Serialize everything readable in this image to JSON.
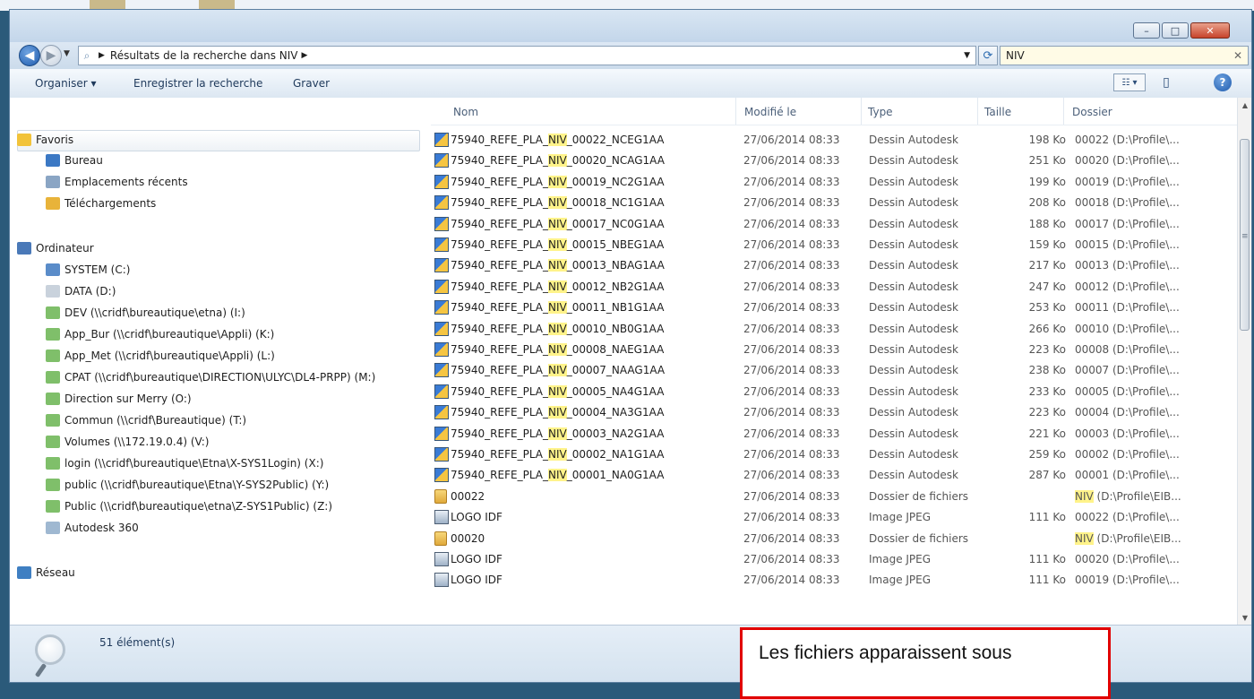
{
  "address": {
    "path": "Résultats de la recherche dans NIV",
    "search_value": "NIV"
  },
  "window_controls": {
    "minimize": "–",
    "maximize": "□",
    "close": "✕"
  },
  "toolbar": {
    "organize": "Organiser ▾",
    "save_search": "Enregistrer la recherche",
    "burn": "Graver",
    "view_menu": "☷ ▾",
    "help": "?"
  },
  "nav": {
    "favorites": {
      "label": "Favoris",
      "items": [
        "Bureau",
        "Emplacements récents",
        "Téléchargements"
      ]
    },
    "computer": {
      "label": "Ordinateur",
      "items": [
        "SYSTEM (C:)",
        "DATA (D:)",
        "DEV (\\\\cridf\\bureautique\\etna) (I:)",
        "App_Bur (\\\\cridf\\bureautique\\Appli) (K:)",
        "App_Met (\\\\cridf\\bureautique\\Appli) (L:)",
        "CPAT (\\\\cridf\\bureautique\\DIRECTION\\ULYC\\DL4-PRPP) (M:)",
        "Direction sur Merry (O:)",
        "Commun (\\\\cridf\\Bureautique) (T:)",
        "Volumes (\\\\172.19.0.4) (V:)",
        "login (\\\\cridf\\bureautique\\Etna\\X-SYS1Login) (X:)",
        "public (\\\\cridf\\bureautique\\Etna\\Y-SYS2Public) (Y:)",
        "Public (\\\\cridf\\bureautique\\etna\\Z-SYS1Public) (Z:)",
        "Autodesk 360"
      ]
    },
    "network": {
      "label": "Réseau"
    }
  },
  "columns": {
    "name": "Nom",
    "modified": "Modifié le",
    "type": "Type",
    "size": "Taille",
    "folder": "Dossier"
  },
  "files": [
    {
      "pre": "75940_REFE_PLA_",
      "hl": "NIV",
      "post": "_00022_NCEG1AA",
      "date": "27/06/2014 08:33",
      "type": "Dessin Autodesk",
      "size": "198 Ko",
      "fhl": "",
      "folder": "00022 (D:\\Profile\\...",
      "icon": "dwg"
    },
    {
      "pre": "75940_REFE_PLA_",
      "hl": "NIV",
      "post": "_00020_NCAG1AA",
      "date": "27/06/2014 08:33",
      "type": "Dessin Autodesk",
      "size": "251 Ko",
      "fhl": "",
      "folder": "00020 (D:\\Profile\\...",
      "icon": "dwg"
    },
    {
      "pre": "75940_REFE_PLA_",
      "hl": "NIV",
      "post": "_00019_NC2G1AA",
      "date": "27/06/2014 08:33",
      "type": "Dessin Autodesk",
      "size": "199 Ko",
      "fhl": "",
      "folder": "00019 (D:\\Profile\\...",
      "icon": "dwg"
    },
    {
      "pre": "75940_REFE_PLA_",
      "hl": "NIV",
      "post": "_00018_NC1G1AA",
      "date": "27/06/2014 08:33",
      "type": "Dessin Autodesk",
      "size": "208 Ko",
      "fhl": "",
      "folder": "00018 (D:\\Profile\\...",
      "icon": "dwg"
    },
    {
      "pre": "75940_REFE_PLA_",
      "hl": "NIV",
      "post": "_00017_NC0G1AA",
      "date": "27/06/2014 08:33",
      "type": "Dessin Autodesk",
      "size": "188 Ko",
      "fhl": "",
      "folder": "00017 (D:\\Profile\\...",
      "icon": "dwg"
    },
    {
      "pre": "75940_REFE_PLA_",
      "hl": "NIV",
      "post": "_00015_NBEG1AA",
      "date": "27/06/2014 08:33",
      "type": "Dessin Autodesk",
      "size": "159 Ko",
      "fhl": "",
      "folder": "00015 (D:\\Profile\\...",
      "icon": "dwg"
    },
    {
      "pre": "75940_REFE_PLA_",
      "hl": "NIV",
      "post": "_00013_NBAG1AA",
      "date": "27/06/2014 08:33",
      "type": "Dessin Autodesk",
      "size": "217 Ko",
      "fhl": "",
      "folder": "00013 (D:\\Profile\\...",
      "icon": "dwg"
    },
    {
      "pre": "75940_REFE_PLA_",
      "hl": "NIV",
      "post": "_00012_NB2G1AA",
      "date": "27/06/2014 08:33",
      "type": "Dessin Autodesk",
      "size": "247 Ko",
      "fhl": "",
      "folder": "00012 (D:\\Profile\\...",
      "icon": "dwg"
    },
    {
      "pre": "75940_REFE_PLA_",
      "hl": "NIV",
      "post": "_00011_NB1G1AA",
      "date": "27/06/2014 08:33",
      "type": "Dessin Autodesk",
      "size": "253 Ko",
      "fhl": "",
      "folder": "00011 (D:\\Profile\\...",
      "icon": "dwg"
    },
    {
      "pre": "75940_REFE_PLA_",
      "hl": "NIV",
      "post": "_00010_NB0G1AA",
      "date": "27/06/2014 08:33",
      "type": "Dessin Autodesk",
      "size": "266 Ko",
      "fhl": "",
      "folder": "00010 (D:\\Profile\\...",
      "icon": "dwg"
    },
    {
      "pre": "75940_REFE_PLA_",
      "hl": "NIV",
      "post": "_00008_NAEG1AA",
      "date": "27/06/2014 08:33",
      "type": "Dessin Autodesk",
      "size": "223 Ko",
      "fhl": "",
      "folder": "00008 (D:\\Profile\\...",
      "icon": "dwg"
    },
    {
      "pre": "75940_REFE_PLA_",
      "hl": "NIV",
      "post": "_00007_NAAG1AA",
      "date": "27/06/2014 08:33",
      "type": "Dessin Autodesk",
      "size": "238 Ko",
      "fhl": "",
      "folder": "00007 (D:\\Profile\\...",
      "icon": "dwg"
    },
    {
      "pre": "75940_REFE_PLA_",
      "hl": "NIV",
      "post": "_00005_NA4G1AA",
      "date": "27/06/2014 08:33",
      "type": "Dessin Autodesk",
      "size": "233 Ko",
      "fhl": "",
      "folder": "00005 (D:\\Profile\\...",
      "icon": "dwg"
    },
    {
      "pre": "75940_REFE_PLA_",
      "hl": "NIV",
      "post": "_00004_NA3G1AA",
      "date": "27/06/2014 08:33",
      "type": "Dessin Autodesk",
      "size": "223 Ko",
      "fhl": "",
      "folder": "00004 (D:\\Profile\\...",
      "icon": "dwg"
    },
    {
      "pre": "75940_REFE_PLA_",
      "hl": "NIV",
      "post": "_00003_NA2G1AA",
      "date": "27/06/2014 08:33",
      "type": "Dessin Autodesk",
      "size": "221 Ko",
      "fhl": "",
      "folder": "00003 (D:\\Profile\\...",
      "icon": "dwg"
    },
    {
      "pre": "75940_REFE_PLA_",
      "hl": "NIV",
      "post": "_00002_NA1G1AA",
      "date": "27/06/2014 08:33",
      "type": "Dessin Autodesk",
      "size": "259 Ko",
      "fhl": "",
      "folder": "00002 (D:\\Profile\\...",
      "icon": "dwg"
    },
    {
      "pre": "75940_REFE_PLA_",
      "hl": "NIV",
      "post": "_00001_NA0G1AA",
      "date": "27/06/2014 08:33",
      "type": "Dessin Autodesk",
      "size": "287 Ko",
      "fhl": "",
      "folder": "00001 (D:\\Profile\\...",
      "icon": "dwg"
    },
    {
      "pre": "00022",
      "hl": "",
      "post": "",
      "date": "27/06/2014 08:33",
      "type": "Dossier de fichiers",
      "size": "",
      "fhl": "NIV",
      "folder": " (D:\\Profile\\EIB...",
      "icon": "folder"
    },
    {
      "pre": "LOGO IDF",
      "hl": "",
      "post": "",
      "date": "27/06/2014 08:33",
      "type": "Image JPEG",
      "size": "111 Ko",
      "fhl": "",
      "folder": "00022 (D:\\Profile\\...",
      "icon": "jpg"
    },
    {
      "pre": "00020",
      "hl": "",
      "post": "",
      "date": "27/06/2014 08:33",
      "type": "Dossier de fichiers",
      "size": "",
      "fhl": "NIV",
      "folder": " (D:\\Profile\\EIB...",
      "icon": "folder"
    },
    {
      "pre": "LOGO IDF",
      "hl": "",
      "post": "",
      "date": "27/06/2014 08:33",
      "type": "Image JPEG",
      "size": "111 Ko",
      "fhl": "",
      "folder": "00020 (D:\\Profile\\...",
      "icon": "jpg"
    },
    {
      "pre": "LOGO IDF",
      "hl": "",
      "post": "",
      "date": "27/06/2014 08:33",
      "type": "Image JPEG",
      "size": "111 Ko",
      "fhl": "",
      "folder": "00019 (D:\\Profile\\...",
      "icon": "jpg"
    }
  ],
  "status": {
    "count": "51 élément(s)"
  },
  "callout": {
    "text": "Les fichiers apparaissent sous"
  }
}
